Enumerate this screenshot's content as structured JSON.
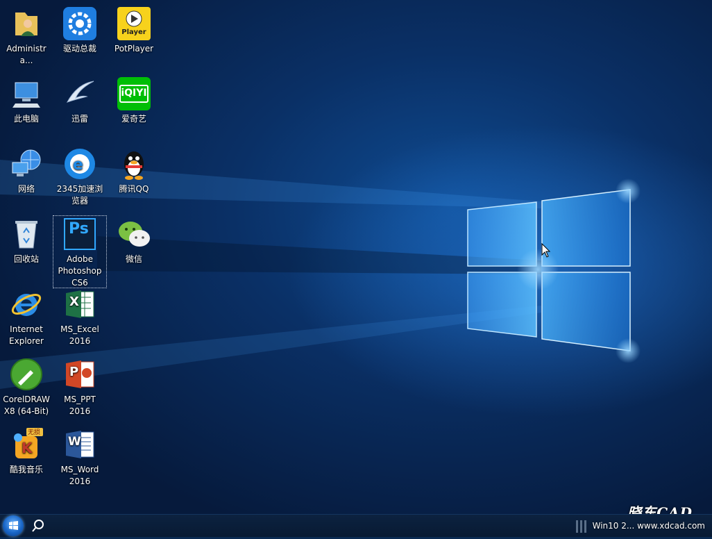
{
  "desktop": {
    "icons": [
      {
        "label": "Administra...",
        "icon": "user-folder-icon"
      },
      {
        "label": "此电脑",
        "icon": "computer-icon"
      },
      {
        "label": "网络",
        "icon": "network-icon"
      },
      {
        "label": "回收站",
        "icon": "recycle-bin-icon"
      },
      {
        "label": "Internet\nExplorer",
        "icon": "internet-explorer-icon"
      },
      {
        "label": "CorelDRAW\nX8 (64-Bit)",
        "icon": "coreldraw-icon"
      },
      {
        "label": "酷我音乐",
        "icon": "kuwo-music-icon",
        "badge": "无损"
      },
      {
        "label": "驱动总裁",
        "icon": "driver-gear-icon"
      },
      {
        "label": "迅雷",
        "icon": "xunlei-icon"
      },
      {
        "label": "2345加速浏\n览器",
        "icon": "browser-2345-icon"
      },
      {
        "label": "Adobe\nPhotoshop\nCS6",
        "icon": "photoshop-icon",
        "glyph": "Ps"
      },
      {
        "label": "MS_Excel\n2016",
        "icon": "excel-icon",
        "glyph": "X"
      },
      {
        "label": "MS_PPT\n2016",
        "icon": "powerpoint-icon",
        "glyph": "P"
      },
      {
        "label": "MS_Word\n2016",
        "icon": "word-icon",
        "glyph": "W"
      },
      {
        "label": "PotPlayer",
        "icon": "potplayer-icon",
        "glyph": "Player"
      },
      {
        "label": "爱奇艺",
        "icon": "iqiyi-icon",
        "glyph": "iQIYI"
      },
      {
        "label": "腾讯QQ",
        "icon": "qq-penguin-icon"
      },
      {
        "label": "微信",
        "icon": "wechat-icon"
      }
    ]
  },
  "taskbar": {
    "tray_text": "Win10 2... www.xdcad.com",
    "watermark": "晓东CAD"
  },
  "colors": {
    "accent": "#1a67c8",
    "taskbar": "#0a1d38"
  }
}
